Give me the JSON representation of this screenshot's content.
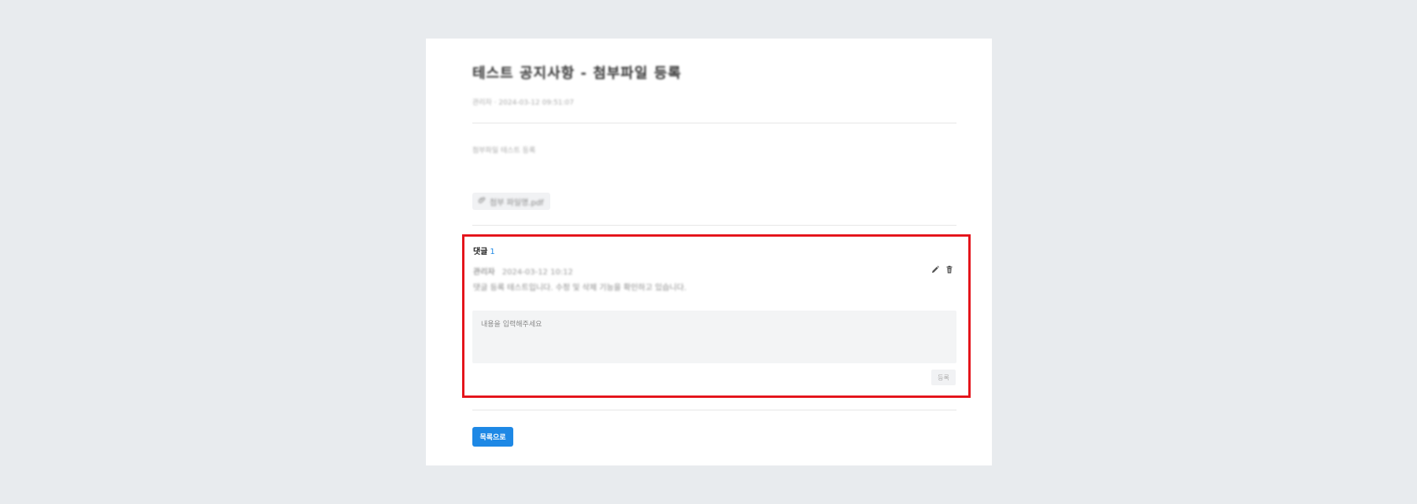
{
  "post": {
    "title": "테스트 공지사항 - 첨부파일 등록",
    "meta": "관리자 · 2024-03-12 09:51:07",
    "body": "첨부파일 테스트 등록",
    "attachment": "첨부 파일명.pdf"
  },
  "comments": {
    "label": "댓글",
    "count": "1",
    "items": [
      {
        "author": "관리자",
        "date": "2024-03-12 10:12",
        "text": "댓글 등록 테스트입니다. 수정 및 삭제 기능을 확인하고 있습니다."
      }
    ],
    "input_placeholder": "내용을 입력해주세요",
    "submit_label": "등록"
  },
  "actions": {
    "back_label": "목록으로"
  },
  "colors": {
    "accent": "#1e88e5",
    "highlight_border": "#e4141b",
    "background": "#e8ebee"
  },
  "icons": [
    "attachment-icon",
    "edit-icon",
    "delete-icon"
  ]
}
